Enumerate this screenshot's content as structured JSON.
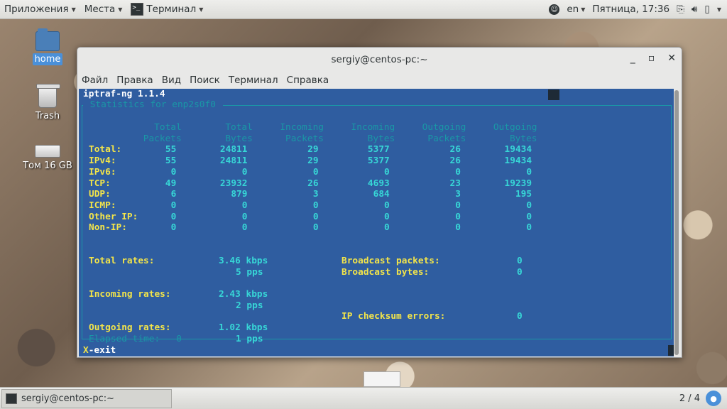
{
  "top_panel": {
    "apps_label": "Приложения",
    "places_label": "Места",
    "terminal_label": "Терминал",
    "lang": "en",
    "clock": "Пятница, 17:36"
  },
  "desktop": {
    "icons": [
      {
        "label": "home",
        "kind": "folder"
      },
      {
        "label": "Trash",
        "kind": "trash"
      },
      {
        "label": "Том 16 GB",
        "kind": "drive"
      }
    ]
  },
  "window": {
    "title": "sergiy@centos-pc:~",
    "menu": [
      "Файл",
      "Правка",
      "Вид",
      "Поиск",
      "Терминал",
      "Справка"
    ]
  },
  "iptraf": {
    "header": "iptraf-ng 1.1.4",
    "box_title": " Statistics for enp2s0f0 ",
    "col_headers_1": "             Total        Total     Incoming     Incoming     Outgoing     Outgoing",
    "col_headers_2": "           Packets        Bytes      Packets        Bytes      Packets        Bytes",
    "rows": [
      {
        "label": "Total:",
        "vals": "        55        24811           29         5377           26        19434"
      },
      {
        "label": "IPv4:",
        "vals": "         55        24811           29         5377           26        19434"
      },
      {
        "label": "IPv6:",
        "vals": "          0            0            0            0            0            0"
      },
      {
        "label": "TCP:",
        "vals": "          49        23932           26         4693           23        19239"
      },
      {
        "label": "UDP:",
        "vals": "           6          879            3          684            3          195"
      },
      {
        "label": "ICMP:",
        "vals": "          0            0            0            0            0            0"
      },
      {
        "label": "Other IP:",
        "vals": "      0            0            0            0            0            0"
      },
      {
        "label": "Non-IP:",
        "vals": "        0            0            0            0            0            0"
      }
    ],
    "total_rates_label": "Total rates:",
    "total_rates_kbps": "3.46 kbps",
    "total_rates_pps": "5 pps",
    "broadcast_packets_label": "Broadcast packets:",
    "broadcast_packets_val": "0",
    "broadcast_bytes_label": "Broadcast bytes:",
    "broadcast_bytes_val": "0",
    "incoming_rates_label": "Incoming rates:",
    "incoming_rates_kbps": "2.43 kbps",
    "incoming_rates_pps": "2 pps",
    "checksum_label": "IP checksum errors:",
    "checksum_val": "0",
    "outgoing_rates_label": "Outgoing rates:",
    "outgoing_rates_kbps": "1.02 kbps",
    "outgoing_rates_pps": "1 pps",
    "elapsed": "Elapsed time:   0",
    "exit_key": "X",
    "exit_label": "-exit"
  },
  "bottom_panel": {
    "task_label": "sergiy@centos-pc:~",
    "workspace": "2 / 4"
  },
  "colors": {
    "terminal_bg": "#2f5da0",
    "header_text": "#ffffff",
    "values_cyan": "#37d6d6",
    "labels_yellow": "#f2e44a",
    "dim_cyan": "#1a97a6"
  }
}
